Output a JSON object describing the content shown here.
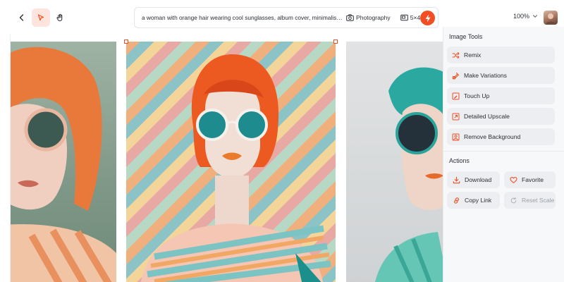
{
  "toolbar": {
    "back_icon": "chevron-left-icon",
    "select_tool_icon": "cursor-arrow-icon",
    "pan_tool_icon": "hand-icon"
  },
  "prompt": {
    "text": "a woman with orange hair wearing cool sunglasses, album cover, minimalism st...",
    "style_label": "Photography",
    "aspect_label": "5×4",
    "generate_icon": "lightning-icon"
  },
  "zoom": {
    "label": "100%"
  },
  "panel": {
    "image_tools_title": "Image Tools",
    "tools": [
      {
        "label": "Remix",
        "icon": "shuffle-icon"
      },
      {
        "label": "Make Variations",
        "icon": "variations-icon"
      },
      {
        "label": "Touch Up",
        "icon": "touch-up-icon"
      },
      {
        "label": "Detailed Upscale",
        "icon": "upscale-icon"
      },
      {
        "label": "Remove Background",
        "icon": "remove-background-icon"
      }
    ],
    "actions_title": "Actions",
    "actions": [
      {
        "label": "Download",
        "icon": "download-icon"
      },
      {
        "label": "Favorite",
        "icon": "heart-icon"
      },
      {
        "label": "Copy Link",
        "icon": "link-icon"
      },
      {
        "label": "Reset Scale",
        "icon": "reset-icon",
        "disabled": true
      }
    ]
  },
  "colors": {
    "accent": "#f24e24",
    "panel_bg": "#f7f8f9",
    "button_bg": "#eceef1"
  }
}
